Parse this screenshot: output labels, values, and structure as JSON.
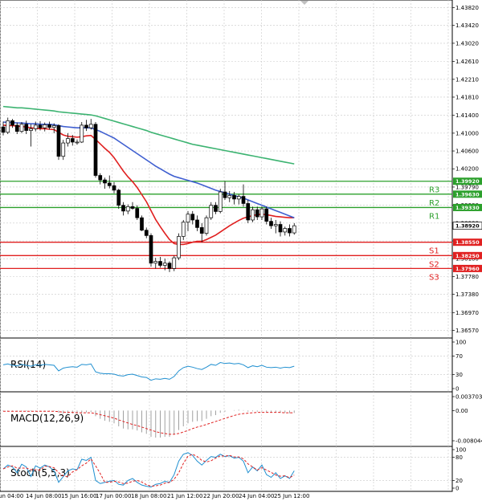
{
  "chart_data": {
    "type": "candlestick",
    "grid": true,
    "price_axis_ticks": [
      "1.43820",
      "1.43420",
      "1.43020",
      "1.42610",
      "1.42210",
      "1.41810",
      "1.41400",
      "1.41000",
      "1.40600",
      "1.40200",
      "1.39790",
      "1.39380",
      "1.38980",
      "1.38580",
      "1.38180",
      "1.37780",
      "1.37380",
      "1.36970",
      "1.36570"
    ],
    "price_range": [
      1.3647,
      1.4392
    ],
    "current_price": "1.38920",
    "pivot_levels": [
      {
        "name": "R3",
        "value": 1.3992,
        "label": "1.39920",
        "color": "#2ca02c"
      },
      {
        "name": "R2",
        "value": 1.3963,
        "label": "1.39630",
        "color": "#2ca02c"
      },
      {
        "name": "R1",
        "value": 1.3933,
        "label": "1.39330",
        "color": "#2ca02c"
      },
      {
        "name": "S1",
        "value": 1.3855,
        "label": "1.38550",
        "color": "#e02020"
      },
      {
        "name": "S2",
        "value": 1.3825,
        "label": "1.38250",
        "color": "#e02020"
      },
      {
        "name": "S3",
        "value": 1.3796,
        "label": "1.37960",
        "color": "#e02020"
      }
    ],
    "time_labels": [
      "Jun 04:00",
      "14 Jun 08:00",
      "15 Jun 16:00",
      "17 Jun 00:00",
      "18 Jun 08:00",
      "21 Jun 12:00",
      "22 Jun 20:00",
      "24 Jun 04:00",
      "25 Jun 12:00"
    ],
    "candles": [
      {
        "o": 1.4114,
        "h": 1.4126,
        "l": 1.4095,
        "c": 1.4102
      },
      {
        "o": 1.4102,
        "h": 1.4135,
        "l": 1.4098,
        "c": 1.4128
      },
      {
        "o": 1.4128,
        "h": 1.4132,
        "l": 1.4112,
        "c": 1.4118
      },
      {
        "o": 1.4118,
        "h": 1.4124,
        "l": 1.4098,
        "c": 1.4104
      },
      {
        "o": 1.4104,
        "h": 1.4125,
        "l": 1.41,
        "c": 1.412
      },
      {
        "o": 1.412,
        "h": 1.4128,
        "l": 1.4098,
        "c": 1.4106
      },
      {
        "o": 1.4106,
        "h": 1.412,
        "l": 1.407,
        "c": 1.411
      },
      {
        "o": 1.411,
        "h": 1.4126,
        "l": 1.4104,
        "c": 1.4118
      },
      {
        "o": 1.4118,
        "h": 1.4127,
        "l": 1.4106,
        "c": 1.4112
      },
      {
        "o": 1.4112,
        "h": 1.4124,
        "l": 1.4104,
        "c": 1.4119
      },
      {
        "o": 1.4119,
        "h": 1.4126,
        "l": 1.4108,
        "c": 1.4113
      },
      {
        "o": 1.4113,
        "h": 1.4122,
        "l": 1.41,
        "c": 1.4117
      },
      {
        "o": 1.4117,
        "h": 1.412,
        "l": 1.404,
        "c": 1.4048
      },
      {
        "o": 1.4048,
        "h": 1.4085,
        "l": 1.404,
        "c": 1.4078
      },
      {
        "o": 1.4078,
        "h": 1.41,
        "l": 1.407,
        "c": 1.4088
      },
      {
        "o": 1.4088,
        "h": 1.4096,
        "l": 1.4072,
        "c": 1.408
      },
      {
        "o": 1.408,
        "h": 1.4086,
        "l": 1.4074,
        "c": 1.408
      },
      {
        "o": 1.408,
        "h": 1.4125,
        "l": 1.4078,
        "c": 1.4118
      },
      {
        "o": 1.4118,
        "h": 1.413,
        "l": 1.4105,
        "c": 1.4112
      },
      {
        "o": 1.4112,
        "h": 1.4132,
        "l": 1.4108,
        "c": 1.412
      },
      {
        "o": 1.412,
        "h": 1.4125,
        "l": 1.4,
        "c": 1.4005
      },
      {
        "o": 1.4005,
        "h": 1.401,
        "l": 1.3985,
        "c": 1.3995
      },
      {
        "o": 1.3995,
        "h": 1.4,
        "l": 1.3975,
        "c": 1.3988
      },
      {
        "o": 1.3988,
        "h": 1.4005,
        "l": 1.3976,
        "c": 1.3982
      },
      {
        "o": 1.3982,
        "h": 1.399,
        "l": 1.3965,
        "c": 1.3972
      },
      {
        "o": 1.3972,
        "h": 1.3975,
        "l": 1.393,
        "c": 1.3938
      },
      {
        "o": 1.3938,
        "h": 1.3945,
        "l": 1.3915,
        "c": 1.3925
      },
      {
        "o": 1.3925,
        "h": 1.394,
        "l": 1.3918,
        "c": 1.3935
      },
      {
        "o": 1.3935,
        "h": 1.3945,
        "l": 1.3928,
        "c": 1.3931
      },
      {
        "o": 1.3931,
        "h": 1.3938,
        "l": 1.3905,
        "c": 1.391
      },
      {
        "o": 1.391,
        "h": 1.3915,
        "l": 1.388,
        "c": 1.3882
      },
      {
        "o": 1.3882,
        "h": 1.3888,
        "l": 1.3864,
        "c": 1.387
      },
      {
        "o": 1.387,
        "h": 1.3875,
        "l": 1.38,
        "c": 1.3808
      },
      {
        "o": 1.3808,
        "h": 1.382,
        "l": 1.3796,
        "c": 1.3812
      },
      {
        "o": 1.3812,
        "h": 1.3822,
        "l": 1.3798,
        "c": 1.3803
      },
      {
        "o": 1.3803,
        "h": 1.3818,
        "l": 1.3792,
        "c": 1.3808
      },
      {
        "o": 1.3808,
        "h": 1.3812,
        "l": 1.3788,
        "c": 1.3796
      },
      {
        "o": 1.3796,
        "h": 1.3825,
        "l": 1.379,
        "c": 1.382
      },
      {
        "o": 1.382,
        "h": 1.3875,
        "l": 1.3815,
        "c": 1.3868
      },
      {
        "o": 1.3868,
        "h": 1.3905,
        "l": 1.386,
        "c": 1.39
      },
      {
        "o": 1.39,
        "h": 1.3925,
        "l": 1.388,
        "c": 1.3918
      },
      {
        "o": 1.3918,
        "h": 1.3925,
        "l": 1.3895,
        "c": 1.3905
      },
      {
        "o": 1.3905,
        "h": 1.3915,
        "l": 1.388,
        "c": 1.3888
      },
      {
        "o": 1.3888,
        "h": 1.3898,
        "l": 1.3855,
        "c": 1.3875
      },
      {
        "o": 1.3875,
        "h": 1.3915,
        "l": 1.387,
        "c": 1.391
      },
      {
        "o": 1.391,
        "h": 1.3945,
        "l": 1.3905,
        "c": 1.3938
      },
      {
        "o": 1.3938,
        "h": 1.3945,
        "l": 1.3918,
        "c": 1.3924
      },
      {
        "o": 1.3924,
        "h": 1.3975,
        "l": 1.392,
        "c": 1.3968
      },
      {
        "o": 1.3968,
        "h": 1.3992,
        "l": 1.395,
        "c": 1.3955
      },
      {
        "o": 1.3955,
        "h": 1.397,
        "l": 1.3945,
        "c": 1.396
      },
      {
        "o": 1.396,
        "h": 1.3968,
        "l": 1.394,
        "c": 1.3952
      },
      {
        "o": 1.3952,
        "h": 1.3962,
        "l": 1.394,
        "c": 1.3958
      },
      {
        "o": 1.3958,
        "h": 1.3985,
        "l": 1.3935,
        "c": 1.3942
      },
      {
        "o": 1.3942,
        "h": 1.395,
        "l": 1.3898,
        "c": 1.3905
      },
      {
        "o": 1.3905,
        "h": 1.3935,
        "l": 1.39,
        "c": 1.3928
      },
      {
        "o": 1.3928,
        "h": 1.3935,
        "l": 1.3905,
        "c": 1.3912
      },
      {
        "o": 1.3912,
        "h": 1.3935,
        "l": 1.3905,
        "c": 1.393
      },
      {
        "o": 1.393,
        "h": 1.3935,
        "l": 1.3895,
        "c": 1.3902
      },
      {
        "o": 1.3902,
        "h": 1.391,
        "l": 1.3885,
        "c": 1.3892
      },
      {
        "o": 1.3892,
        "h": 1.3905,
        "l": 1.3875,
        "c": 1.3895
      },
      {
        "o": 1.3895,
        "h": 1.3902,
        "l": 1.3868,
        "c": 1.3878
      },
      {
        "o": 1.3878,
        "h": 1.389,
        "l": 1.387,
        "c": 1.3886
      },
      {
        "o": 1.3886,
        "h": 1.3895,
        "l": 1.3868,
        "c": 1.3876
      },
      {
        "o": 1.3876,
        "h": 1.3898,
        "l": 1.3872,
        "c": 1.3892
      }
    ],
    "moving_averages": [
      {
        "color": "#e02020",
        "values": [
          1.4118,
          1.4117,
          1.4117,
          1.4116,
          1.4115,
          1.4114,
          1.4112,
          1.4111,
          1.411,
          1.411,
          1.4109,
          1.4108,
          1.4102,
          1.4096,
          1.4093,
          1.4092,
          1.4091,
          1.4092,
          1.4094,
          1.4095,
          1.4086,
          1.4076,
          1.4066,
          1.4057,
          1.4045,
          1.403,
          1.4015,
          1.4002,
          1.3991,
          1.3978,
          1.3962,
          1.3946,
          1.3926,
          1.3906,
          1.389,
          1.3875,
          1.3861,
          1.3852,
          1.385,
          1.385,
          1.3852,
          1.3855,
          1.3857,
          1.3857,
          1.3861,
          1.3866,
          1.3871,
          1.3878,
          1.3885,
          1.3892,
          1.3898,
          1.3904,
          1.3909,
          1.3912,
          1.3915,
          1.3917,
          1.3918,
          1.3917,
          1.3915,
          1.3913,
          1.3912,
          1.3911,
          1.391,
          1.391
        ]
      },
      {
        "color": "#3f5fd0",
        "values": [
          1.4125,
          1.4124,
          1.4124,
          1.4123,
          1.4123,
          1.4122,
          1.4121,
          1.4121,
          1.412,
          1.412,
          1.412,
          1.4119,
          1.4117,
          1.4115,
          1.4114,
          1.4113,
          1.4112,
          1.4112,
          1.4112,
          1.4112,
          1.4108,
          1.4104,
          1.4099,
          1.4094,
          1.4089,
          1.4082,
          1.4075,
          1.4068,
          1.4061,
          1.4054,
          1.4047,
          1.404,
          1.4033,
          1.4026,
          1.402,
          1.4014,
          1.4008,
          1.4003,
          1.4,
          1.3997,
          1.3994,
          1.3991,
          1.3988,
          1.3984,
          1.398,
          1.3976,
          1.3972,
          1.3969,
          1.3966,
          1.3963,
          1.396,
          1.3957,
          1.3954,
          1.395,
          1.3946,
          1.3942,
          1.3938,
          1.3934,
          1.393,
          1.3926,
          1.3922,
          1.3918,
          1.3914,
          1.391
        ]
      },
      {
        "color": "#3cb371",
        "values": [
          1.416,
          1.4159,
          1.4158,
          1.4157,
          1.4157,
          1.4156,
          1.4155,
          1.4154,
          1.4153,
          1.4152,
          1.4151,
          1.415,
          1.4148,
          1.4147,
          1.4146,
          1.4145,
          1.4144,
          1.4143,
          1.4142,
          1.4141,
          1.4139,
          1.4136,
          1.4133,
          1.413,
          1.4127,
          1.4124,
          1.4121,
          1.4118,
          1.4115,
          1.4112,
          1.4109,
          1.4106,
          1.4102,
          1.4099,
          1.4096,
          1.4093,
          1.409,
          1.4087,
          1.4084,
          1.4081,
          1.4078,
          1.4075,
          1.4073,
          1.4071,
          1.4069,
          1.4067,
          1.4065,
          1.4063,
          1.4061,
          1.4059,
          1.4057,
          1.4055,
          1.4053,
          1.4051,
          1.4049,
          1.4047,
          1.4045,
          1.4043,
          1.4041,
          1.4039,
          1.4037,
          1.4035,
          1.4033,
          1.4031
        ]
      }
    ],
    "indicators": {
      "rsi": {
        "label": "RSI(14)",
        "axis": [
          "100",
          "70",
          "30",
          "0"
        ],
        "range": [
          0,
          100
        ],
        "levels": [
          70,
          30
        ],
        "values": [
          51,
          53,
          50,
          49,
          52,
          50,
          48,
          51,
          50,
          52,
          51,
          50,
          38,
          44,
          46,
          47,
          46,
          52,
          51,
          53,
          36,
          33,
          32,
          32,
          31,
          28,
          27,
          30,
          31,
          28,
          25,
          24,
          18,
          21,
          20,
          22,
          20,
          26,
          38,
          45,
          48,
          46,
          43,
          41,
          46,
          52,
          50,
          56,
          54,
          55,
          53,
          54,
          51,
          45,
          49,
          47,
          50,
          46,
          45,
          46,
          44,
          46,
          45,
          48
        ]
      },
      "macd": {
        "label": "MACD(12,26,9)",
        "axis": [
          "0.003703",
          "0.00",
          "-0.008044"
        ],
        "range": [
          -0.008044,
          0.003703
        ],
        "histogram": [
          -0.0002,
          -0.0002,
          -0.0002,
          -0.0002,
          -0.0002,
          -0.0002,
          -0.0002,
          -0.0002,
          -0.0002,
          -0.0002,
          -0.0002,
          -0.0002,
          -0.0006,
          -0.0008,
          -0.0008,
          -0.0008,
          -0.0008,
          -0.0006,
          -0.0005,
          -0.0004,
          -0.0015,
          -0.0022,
          -0.0027,
          -0.003,
          -0.0034,
          -0.0042,
          -0.0048,
          -0.005,
          -0.005,
          -0.0053,
          -0.0058,
          -0.0062,
          -0.007,
          -0.0072,
          -0.0072,
          -0.007,
          -0.007,
          -0.0064,
          -0.0052,
          -0.0042,
          -0.0034,
          -0.003,
          -0.0028,
          -0.0028,
          -0.0022,
          -0.0015,
          -0.0012,
          -0.0006,
          -0.0003,
          0.0,
          0.0001,
          0.0002,
          0.0001,
          -0.0003,
          -0.0002,
          -0.0003,
          -0.0002,
          -0.0004,
          -0.0005,
          -0.0005,
          -0.0006,
          -0.0006,
          -0.0007,
          -0.0006
        ],
        "signal": [
          -0.0002,
          -0.0002,
          -0.0002,
          -0.0002,
          -0.0002,
          -0.0002,
          -0.0002,
          -0.0002,
          -0.0002,
          -0.0002,
          -0.0002,
          -0.0002,
          -0.0003,
          -0.0004,
          -0.0005,
          -0.0005,
          -0.0006,
          -0.0006,
          -0.0006,
          -0.0006,
          -0.0008,
          -0.0011,
          -0.0014,
          -0.0017,
          -0.002,
          -0.0025,
          -0.0029,
          -0.0033,
          -0.0037,
          -0.004,
          -0.0044,
          -0.0048,
          -0.0052,
          -0.0056,
          -0.0059,
          -0.0061,
          -0.0063,
          -0.0063,
          -0.0061,
          -0.0057,
          -0.0053,
          -0.0048,
          -0.0044,
          -0.0041,
          -0.0037,
          -0.0033,
          -0.0029,
          -0.0025,
          -0.0021,
          -0.0017,
          -0.0013,
          -0.001,
          -0.0008,
          -0.0007,
          -0.0006,
          -0.0005,
          -0.0005,
          -0.0005,
          -0.0005,
          -0.0005,
          -0.0005,
          -0.0006,
          -0.0006,
          -0.0006
        ]
      },
      "stoch": {
        "label": "Stoch(5,5,3)",
        "axis": [
          "100",
          "80",
          "20",
          "0"
        ],
        "range": [
          0,
          100
        ],
        "levels": [
          80,
          20
        ],
        "k": [
          50,
          60,
          55,
          40,
          62,
          55,
          30,
          58,
          52,
          60,
          55,
          45,
          15,
          30,
          45,
          50,
          48,
          75,
          72,
          80,
          20,
          12,
          15,
          18,
          20,
          10,
          8,
          20,
          25,
          15,
          8,
          5,
          3,
          10,
          12,
          18,
          15,
          35,
          70,
          88,
          92,
          85,
          70,
          60,
          72,
          82,
          80,
          88,
          82,
          84,
          78,
          80,
          70,
          40,
          55,
          45,
          60,
          35,
          28,
          40,
          25,
          32,
          25,
          45
        ],
        "d": [
          50,
          55,
          58,
          52,
          52,
          52,
          48,
          48,
          47,
          57,
          56,
          53,
          40,
          32,
          30,
          42,
          48,
          58,
          65,
          76,
          58,
          38,
          15,
          15,
          18,
          16,
          12,
          13,
          18,
          20,
          16,
          9,
          5,
          6,
          8,
          13,
          15,
          23,
          40,
          64,
          83,
          88,
          82,
          72,
          68,
          71,
          78,
          84,
          83,
          85,
          81,
          81,
          76,
          63,
          55,
          47,
          53,
          47,
          41,
          34,
          31,
          32,
          27,
          34
        ]
      }
    }
  }
}
